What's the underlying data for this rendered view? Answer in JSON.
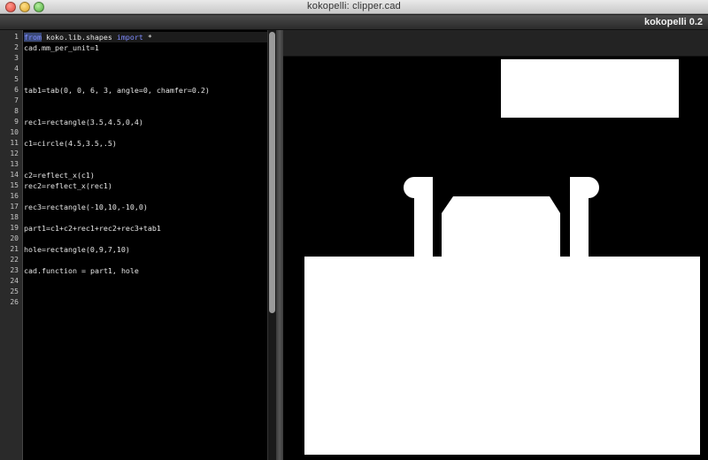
{
  "window": {
    "title": "kokopelli:  clipper.cad"
  },
  "app": {
    "name": "kokopelli 0.2"
  },
  "editor": {
    "lines": [
      "from koko.lib.shapes import *",
      "cad.mm_per_unit=1",
      "",
      "",
      "",
      "tab1=tab(0, 0, 6, 3, angle=0, chamfer=0.2)",
      "",
      "",
      "rec1=rectangle(3.5,4.5,0,4)",
      "",
      "c1=circle(4.5,3.5,.5)",
      "",
      "",
      "c2=reflect_x(c1)",
      "rec2=reflect_x(rec1)",
      "",
      "rec3=rectangle(-10,10,-10,0)",
      "",
      "part1=c1+c2+rec1+rec2+rec3+tab1",
      "",
      "hole=rectangle(0,9,7,10)",
      "",
      "cad.function = part1, hole",
      "",
      "",
      ""
    ],
    "line_numbers": [
      "1",
      "2",
      "3",
      "4",
      "5",
      "6",
      "7",
      "8",
      "9",
      "10",
      "11",
      "12",
      "13",
      "14",
      "15",
      "16",
      "17",
      "18",
      "19",
      "20",
      "21",
      "22",
      "23",
      "24",
      "25",
      "26"
    ],
    "keywords": [
      "from",
      "import"
    ]
  },
  "colors": {
    "editor_bg": "#000000",
    "shape_fill": "#ffffff",
    "keyword": "#7f8cff"
  }
}
